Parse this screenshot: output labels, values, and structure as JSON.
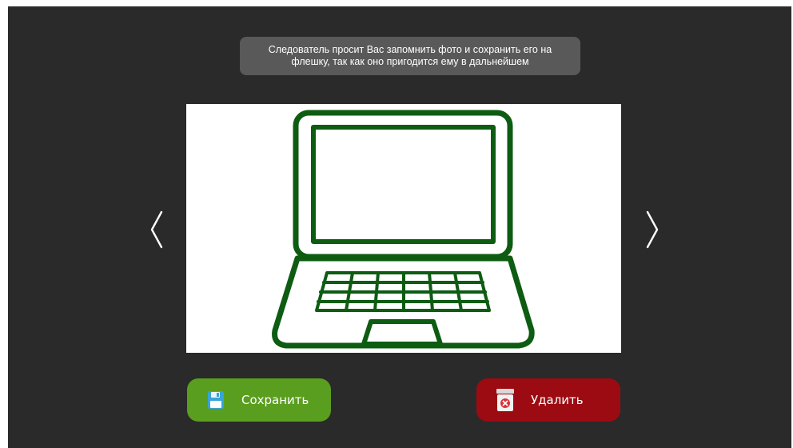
{
  "instruction": {
    "line1": "Следователь просит Вас запомнить фото и сохранить его на",
    "line2": "флешку, так как оно пригодится ему в дальнейшем"
  },
  "photo": {
    "subject": "laptop-icon",
    "stroke_color": "#0d5c12",
    "background": "#ffffff"
  },
  "navigation": {
    "prev_icon": "chevron-left-icon",
    "next_icon": "chevron-right-icon"
  },
  "buttons": {
    "save": {
      "label": "Сохранить",
      "icon": "floppy-disk-icon",
      "color": "#5a9e1f"
    },
    "delete": {
      "label": "Удалить",
      "icon": "trash-bin-icon",
      "color": "#9c0b12"
    }
  },
  "colors": {
    "screen_background": "#2a2a2a",
    "instruction_background": "#595959"
  }
}
